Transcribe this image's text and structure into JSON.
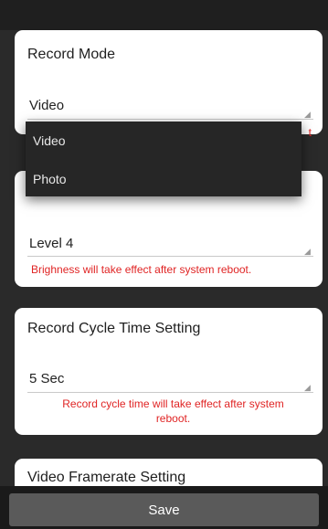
{
  "record_mode": {
    "title": "Record Mode",
    "value": "Video",
    "warning_visible_fragment": "t"
  },
  "dropdown": {
    "options": [
      "Video",
      "Photo"
    ]
  },
  "brightness": {
    "value": "Level 4",
    "warning": "Brighness will take effect after system reboot."
  },
  "record_cycle": {
    "title": "Record Cycle Time Setting",
    "value": "5 Sec",
    "warning_line1": "Record cycle time will take effect after system",
    "warning_line2": "reboot."
  },
  "video_framerate": {
    "title": "Video Framerate Setting"
  },
  "footer": {
    "save_label": "Save"
  },
  "colors": {
    "background": "#2a2a2a",
    "card": "#ffffff",
    "warning": "#e02424",
    "dropdown": "#262626",
    "save_button": "#5a5a5a"
  }
}
